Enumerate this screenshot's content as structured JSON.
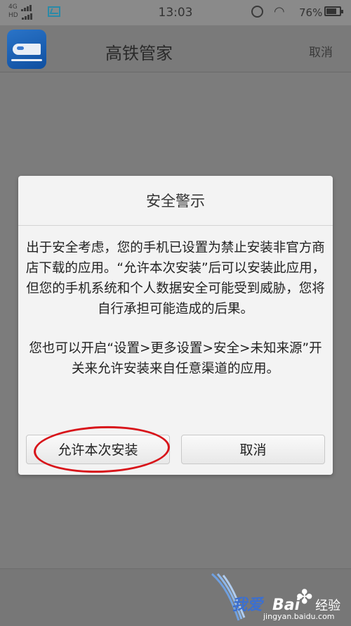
{
  "status_bar": {
    "network_top": "4G",
    "network_bottom": "HD",
    "time": "13:03",
    "battery": "76%",
    "battery_level": 0.76
  },
  "header": {
    "app_name": "高铁管家",
    "cancel_label": "取消"
  },
  "dialog": {
    "title": "安全警示",
    "message_1": "出于安全考虑，您的手机已设置为禁止安装非官方商店下载的应用。“允许本次安装”后可以安装此应用，但您的手机系统和个人数据安全可能受到威胁，您将自行承担可能造成的后果。",
    "message_2": "您也可以开启“设置>更多设置>安全>未知来源”开关来允许安装来自任意渠道的应用。",
    "allow_label": "允许本次安装",
    "cancel_label": "取消"
  },
  "watermark": {
    "text": "我爱",
    "brand": "Bai",
    "brand_suffix": "经验",
    "url": "jingyan.baidu.com"
  },
  "colors": {
    "highlight_circle": "#d8141a",
    "app_icon": "#1f64b8"
  }
}
